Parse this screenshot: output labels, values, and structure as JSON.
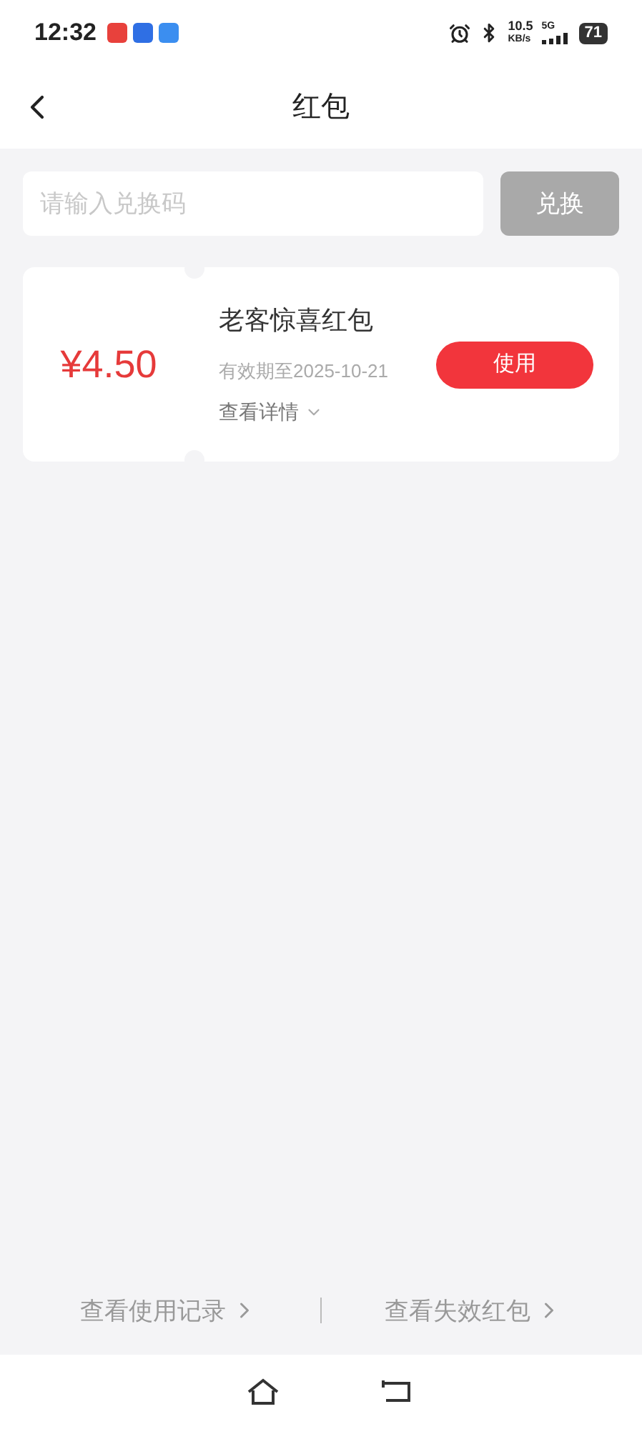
{
  "status_bar": {
    "time": "12:32",
    "speed": "10.5",
    "speed_unit": "KB/s",
    "network": "5G",
    "battery": "71"
  },
  "header": {
    "title": "红包"
  },
  "redeem": {
    "placeholder": "请输入兑换码",
    "button": "兑换",
    "disabled": true
  },
  "coupons": [
    {
      "amount": "¥4.50",
      "title": "老客惊喜红包",
      "expiry": "有效期至2025-10-21",
      "details": "查看详情",
      "action": "使用"
    }
  ],
  "footer_links": [
    "查看使用记录",
    "查看失效红包"
  ]
}
